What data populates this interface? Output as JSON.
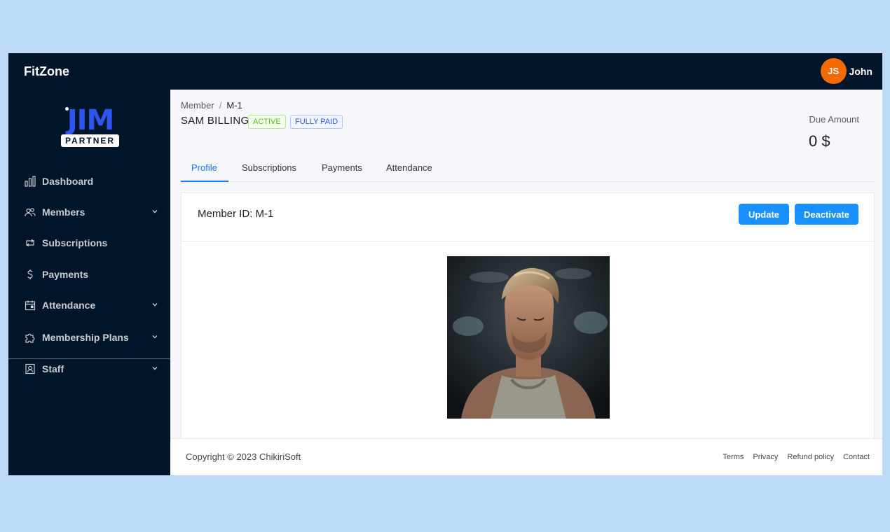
{
  "app": {
    "brand": "FitZone"
  },
  "user": {
    "initials": "JS",
    "name": "John"
  },
  "logo": {
    "word": "JIM",
    "tagline": "PARTNER"
  },
  "sidebar": {
    "items": [
      {
        "label": "Dashboard",
        "icon": "bar-chart-icon"
      },
      {
        "label": "Members",
        "icon": "team-icon",
        "expandable": true
      },
      {
        "label": "Subscriptions",
        "icon": "retweet-icon"
      },
      {
        "label": "Payments",
        "icon": "dollar-icon"
      },
      {
        "label": "Attendance",
        "icon": "calendar-icon",
        "expandable": true
      },
      {
        "label": "Membership Plans",
        "icon": "puzzle-icon",
        "expandable": true
      },
      {
        "label": "Staff",
        "icon": "contacts-icon",
        "expandable": true
      }
    ]
  },
  "breadcrumb": {
    "parent": "Member",
    "separator": "/",
    "current": "M-1"
  },
  "member": {
    "name": "SAM BILLING",
    "status_tag": "ACTIVE",
    "payment_tag": "FULLY PAID",
    "due_label": "Due Amount",
    "due_value": "0 $"
  },
  "tabs": [
    {
      "label": "Profile",
      "active": true
    },
    {
      "label": "Subscriptions",
      "active": false
    },
    {
      "label": "Payments",
      "active": false
    },
    {
      "label": "Attendance",
      "active": false
    }
  ],
  "card": {
    "title": "Member ID: M-1",
    "update_label": "Update",
    "deactivate_label": "Deactivate"
  },
  "footer": {
    "copyright": "Copyright © 2023 ChikiriSoft",
    "links": [
      "Terms",
      "Privacy",
      "Refund policy",
      "Contact"
    ]
  },
  "colors": {
    "page_bg": "#bcdaf5",
    "nav_bg": "#001529",
    "primary": "#1890ff",
    "avatar": "#f56a00",
    "active_tag": "#52c41a",
    "paid_tag": "#2f54eb"
  }
}
